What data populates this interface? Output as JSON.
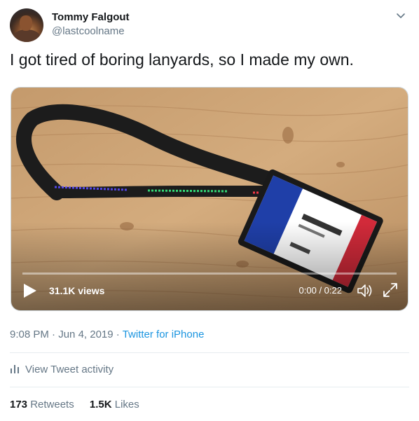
{
  "author": {
    "display_name": "Tommy Falgout",
    "handle": "@lastcoolname"
  },
  "tweet": {
    "text": "I got tired of boring lanyards, so I made my own."
  },
  "video": {
    "views": "31.1K views",
    "time": "0:00 / 0:22",
    "progress": 0.0
  },
  "meta": {
    "time": "9:08 PM",
    "separator1": " · ",
    "date": "Jun 4, 2019",
    "separator2": " · ",
    "source": "Twitter for iPhone"
  },
  "activity": {
    "label": "View Tweet activity"
  },
  "stats": {
    "retweets_count": "173",
    "retweets_label": " Retweets",
    "likes_count": "1.5K",
    "likes_label": " Likes"
  },
  "icons": {
    "chevron": "chevron-down-icon",
    "play": "play-icon",
    "volume": "volume-icon",
    "expand": "expand-icon",
    "activity": "bar-chart-icon"
  },
  "colors": {
    "link": "#1b95e0",
    "secondary_text": "#657786",
    "primary_text": "#14171a"
  }
}
